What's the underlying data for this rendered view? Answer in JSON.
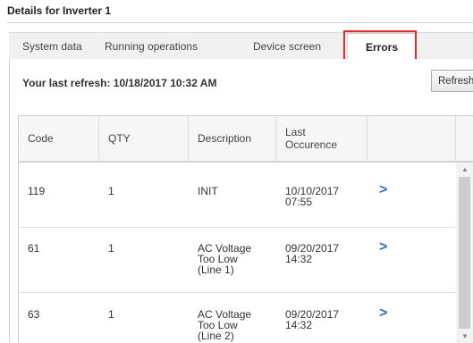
{
  "window": {
    "title": "Details for Inverter 1"
  },
  "tabs": [
    {
      "label": "System data"
    },
    {
      "label": "Running operations"
    },
    {
      "label": "Device screen"
    },
    {
      "label": "Errors",
      "active": true
    }
  ],
  "refresh": {
    "text": "Your last refresh: 10/18/2017 10:32 AM",
    "button_label": "Refresh"
  },
  "table": {
    "headers": {
      "code": "Code",
      "qty": "QTY",
      "description": "Description",
      "last_occurence": [
        "Last",
        "Occurence"
      ]
    },
    "rows": [
      {
        "code": "119",
        "qty": "1",
        "description": [
          "INIT"
        ],
        "last": [
          "10/10/2017",
          "07:55"
        ]
      },
      {
        "code": "61",
        "qty": "1",
        "description": [
          "AC Voltage",
          "Too Low",
          "(Line 1)"
        ],
        "last": [
          "09/20/2017",
          "14:32"
        ]
      },
      {
        "code": "63",
        "qty": "1",
        "description": [
          "AC Voltage",
          "Too Low",
          "(Line 2)"
        ],
        "last": [
          "09/20/2017",
          "14:32"
        ]
      }
    ],
    "row_action_icon": "chevron-right-icon"
  },
  "colors": {
    "highlight": "#e02a2a",
    "link": "#2a6fb8"
  }
}
